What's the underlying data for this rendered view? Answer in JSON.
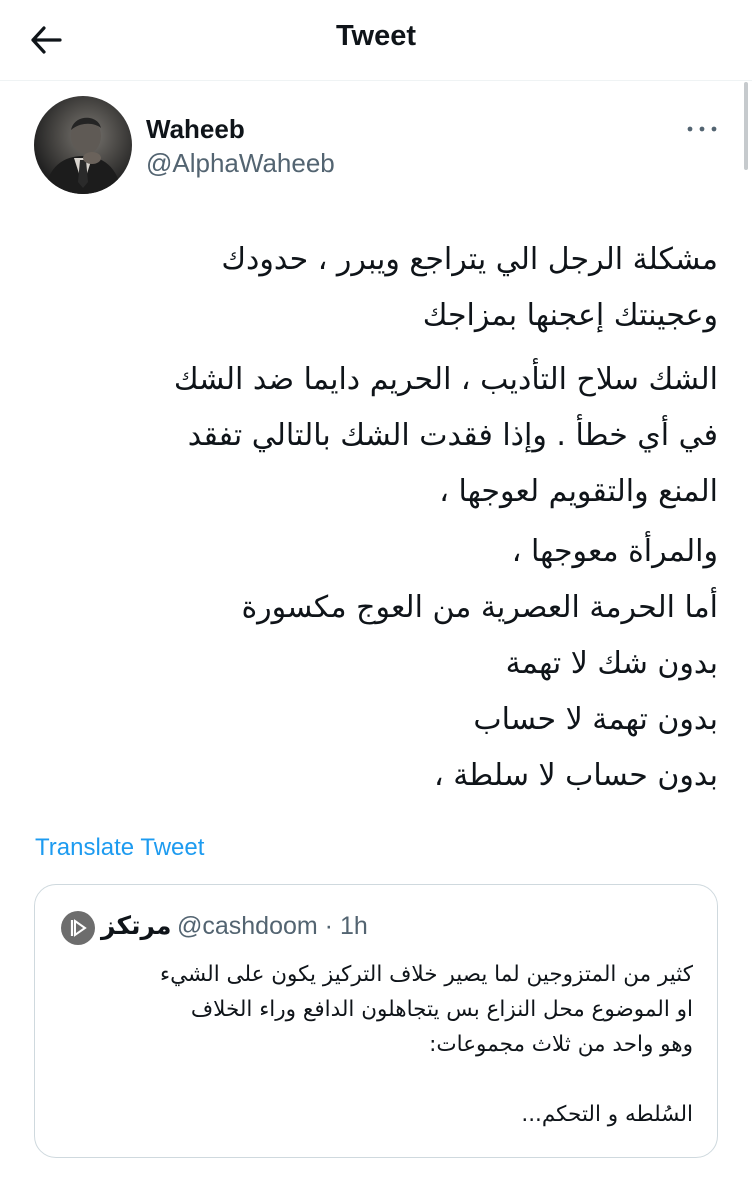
{
  "header": {
    "title": "Tweet",
    "back_icon": "arrow-left-icon"
  },
  "author": {
    "name": "Waheeb",
    "handle": "@AlphaWaheeb",
    "avatar_icon": "profile-photo",
    "more_icon": "more-horizontal-icon"
  },
  "tweet": {
    "paragraphs": [
      [
        "مشكلة الرجل الي يتراجع ويبرر ، حدودك",
        "وعجينتك إعجنها بمزاجك"
      ],
      [
        "الشك سلاح التأديب ، الحريم دايما ضد الشك",
        "في أي خطأ . وإذا فقدت الشك بالتالي تفقد",
        "المنع والتقويم لعوجها ،"
      ],
      [
        "والمرأة معوجها ،",
        "أما الحرمة العصرية من العوج مكسورة"
      ],
      [
        "بدون شك لا تهمة",
        "بدون تهمة لا حساب",
        "بدون حساب لا سلطة ،"
      ]
    ],
    "translate_label": "Translate Tweet"
  },
  "quote": {
    "name": "مرتكز",
    "meta": "@cashdoom · 1h",
    "lines": [
      "كثير من المتزوجين لما يصير خلاف التركيز يكون على الشيء",
      "او الموضوع محل النزاع بس يتجاهلون الدافع وراء الخلاف",
      "وهو واحد من ثلاث مجموعات:",
      "",
      "السُلطه و التحكم..."
    ]
  },
  "colors": {
    "link": "#1d9bf0",
    "secondary_text": "#536471",
    "border": "#cfd9de"
  }
}
